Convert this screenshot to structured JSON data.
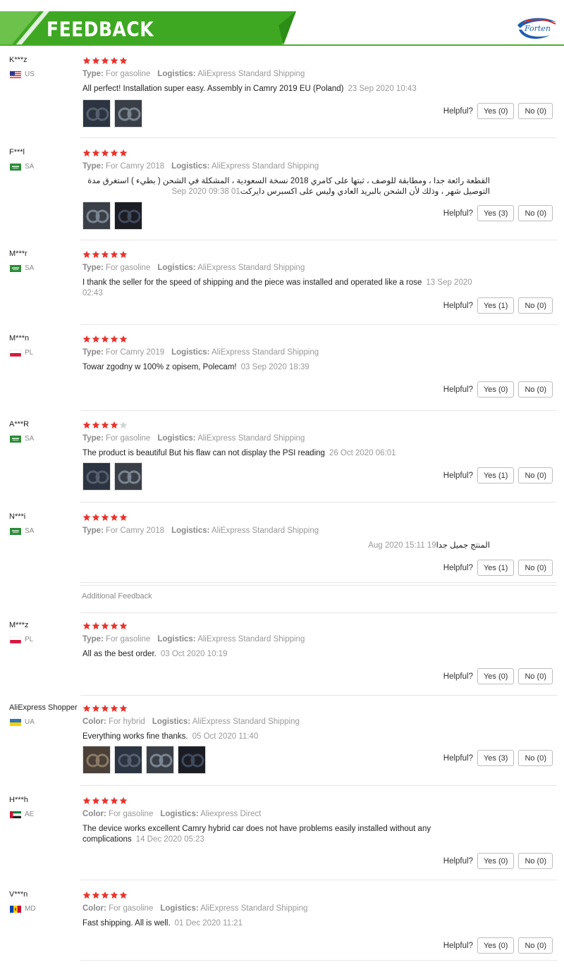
{
  "header": {
    "title": "FEEDBACK",
    "logo_text": "Forten"
  },
  "helpful_label": "Helpful?",
  "additional_feedback": "Additional Feedback",
  "reviews": [
    {
      "user": "K***z",
      "country": "US",
      "rating": 5,
      "attr_label": "Type:",
      "attr_value": "For gasoline",
      "logistics_label": "Logistics:",
      "logistics_value": "AliExpress Standard Shipping",
      "text": "All perfect! Installation super easy. Assembly in Camry 2019 EU (Poland)",
      "date": "23 Sep 2020 10:43",
      "photo_count": 2,
      "yes": "Yes (0)",
      "no": "No (0)"
    },
    {
      "user": "F***l",
      "country": "SA",
      "rating": 5,
      "attr_label": "Type:",
      "attr_value": "For Camry 2018",
      "logistics_label": "Logistics:",
      "logistics_value": "AliExpress Standard Shipping",
      "text": "القطعة رائعة جدا ، ومطابقة للوصف ، ثبتها على كامري 2018 نسخة السعودية ، المشكلة في الشحن ( بطيء ) استغرق مدة التوصيل شهر ، وذلك لأن الشحن بالبريد العادي وليس على اكسبرس دايركت",
      "date": "01 Sep 2020 09:38",
      "photo_count": 2,
      "yes": "Yes (3)",
      "no": "No (0)"
    },
    {
      "user": "M***r",
      "country": "SA",
      "rating": 5,
      "attr_label": "Type:",
      "attr_value": "For gasoline",
      "logistics_label": "Logistics:",
      "logistics_value": "AliExpress Standard Shipping",
      "text": "I thank the seller for the speed of shipping and the piece was installed and operated like a rose",
      "date": "13 Sep 2020 02:43",
      "photo_count": 0,
      "yes": "Yes (1)",
      "no": "No (0)"
    },
    {
      "user": "M***n",
      "country": "PL",
      "rating": 5,
      "attr_label": "Type:",
      "attr_value": "For Camry 2019",
      "logistics_label": "Logistics:",
      "logistics_value": "AliExpress Standard Shipping",
      "text": "Towar zgodny w 100% z opisem, Polecam!",
      "date": "03 Sep 2020 18:39",
      "photo_count": 0,
      "yes": "Yes (0)",
      "no": "No (0)"
    },
    {
      "user": "A***R",
      "country": "SA",
      "rating": 4,
      "attr_label": "Type:",
      "attr_value": "For gasoline",
      "logistics_label": "Logistics:",
      "logistics_value": "AliExpress Standard Shipping",
      "text": "The product is beautiful But his flaw can not display the PSI reading",
      "date": "26 Oct 2020 06:01",
      "photo_count": 2,
      "yes": "Yes (1)",
      "no": "No (0)"
    },
    {
      "user": "N***i",
      "country": "SA",
      "rating": 5,
      "attr_label": "Type:",
      "attr_value": "For Camry 2018",
      "logistics_label": "Logistics:",
      "logistics_value": "AliExpress Standard Shipping",
      "text": "المنتج جميل جدا",
      "date": "19 Aug 2020 15:11",
      "photo_count": 0,
      "yes": "Yes (1)",
      "no": "No (0)"
    },
    {
      "user": "M***z",
      "country": "PL",
      "rating": 5,
      "attr_label": "Type:",
      "attr_value": "For gasoline",
      "logistics_label": "Logistics:",
      "logistics_value": "AliExpress Standard Shipping",
      "text": "All as the best order.",
      "date": "03 Oct 2020 10:19",
      "photo_count": 0,
      "yes": "Yes (0)",
      "no": "No (0)"
    },
    {
      "user": "AliExpress Shopper",
      "country": "UA",
      "rating": 5,
      "attr_label": "Color:",
      "attr_value": "For hybrid",
      "logistics_label": "Logistics:",
      "logistics_value": "AliExpress Standard Shipping",
      "text": "Everything works fine thanks.",
      "date": "05 Oct 2020 11:40",
      "photo_count": 4,
      "yes": "Yes (3)",
      "no": "No (0)"
    },
    {
      "user": "H***h",
      "country": "AE",
      "rating": 5,
      "attr_label": "Color:",
      "attr_value": "For gasoline",
      "logistics_label": "Logistics:",
      "logistics_value": "Aliexpress Direct",
      "text": "The device works excellent Camry hybrid car does not have problems easily installed without any complications",
      "date": "14 Dec 2020 05:23",
      "photo_count": 0,
      "yes": "Yes (0)",
      "no": "No (0)"
    },
    {
      "user": "V***n",
      "country": "MD",
      "rating": 5,
      "attr_label": "Color:",
      "attr_value": "For gasoline",
      "logistics_label": "Logistics:",
      "logistics_value": "AliExpress Standard Shipping",
      "text": "Fast shipping. All is well.",
      "date": "01 Dec 2020 11:21",
      "photo_count": 0,
      "yes": "Yes (0)",
      "no": "No (0)"
    }
  ],
  "colors": {
    "brand_green": "#4caf2a",
    "star_red": "#e8332c",
    "star_empty": "#d5d5d5"
  }
}
